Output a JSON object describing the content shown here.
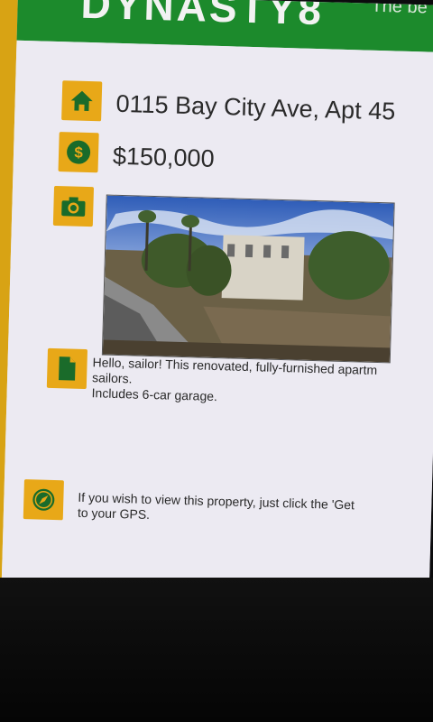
{
  "header": {
    "logo_text": "DYNASTY8",
    "tagline": "The be"
  },
  "listing": {
    "address": "0115 Bay City Ave, Apt 45",
    "price": "$150,000",
    "description_line1": "Hello, sailor! This renovated, fully-furnished apartm",
    "description_line2": "sailors.",
    "description_line3": "Includes 6-car garage.",
    "gps_line1": "If you wish to view this property, just click the 'Get",
    "gps_line2": "to your GPS."
  },
  "icons": {
    "address": "home-icon",
    "price": "dollar-icon",
    "photo": "camera-icon",
    "description": "document-icon",
    "gps": "compass-icon"
  },
  "colors": {
    "brand_green": "#1c8a2c",
    "icon_orange": "#e8a818",
    "icon_green": "#1a6b2a",
    "side_strip": "#d8a314"
  }
}
